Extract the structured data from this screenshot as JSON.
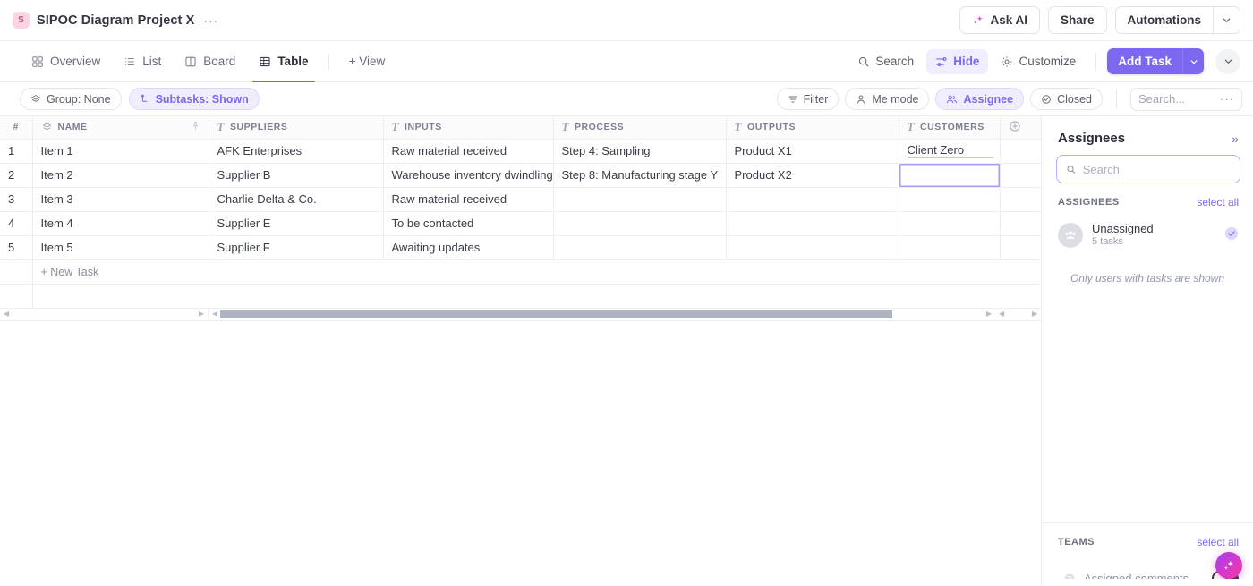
{
  "topbar": {
    "badge_letter": "S",
    "title": "SIPOC Diagram Project X",
    "more_label": "···",
    "ask_ai_label": "Ask AI",
    "share_label": "Share",
    "automations_label": "Automations"
  },
  "viewbar": {
    "tabs": [
      {
        "label": "Overview",
        "icon": "grid-icon",
        "active": false
      },
      {
        "label": "List",
        "icon": "list-icon",
        "active": false
      },
      {
        "label": "Board",
        "icon": "board-icon",
        "active": false
      },
      {
        "label": "Table",
        "icon": "table-icon",
        "active": true
      }
    ],
    "add_view_label": "+ View",
    "search_label": "Search",
    "hide_label": "Hide",
    "customize_label": "Customize",
    "add_task_label": "Add Task"
  },
  "filterbar": {
    "group_label": "Group: None",
    "subtasks_label": "Subtasks: Shown",
    "filter_label": "Filter",
    "me_mode_label": "Me mode",
    "assignee_label": "Assignee",
    "closed_label": "Closed",
    "search_placeholder": "Search...",
    "search_value": "",
    "search_more": "···"
  },
  "table": {
    "columns": [
      {
        "key": "num",
        "label": "#"
      },
      {
        "key": "name",
        "label": "NAME"
      },
      {
        "key": "suppliers",
        "label": "SUPPLIERS"
      },
      {
        "key": "inputs",
        "label": "INPUTS"
      },
      {
        "key": "process",
        "label": "PROCESS"
      },
      {
        "key": "outputs",
        "label": "OUTPUTS"
      },
      {
        "key": "customers",
        "label": "CUSTOMERS"
      }
    ],
    "rows": [
      {
        "num": "1",
        "name": "Item 1",
        "suppliers": "AFK Enterprises",
        "inputs": "Raw material received",
        "process": "Step 4: Sampling",
        "outputs": "Product X1",
        "customers": "Client Zero"
      },
      {
        "num": "2",
        "name": "Item 2",
        "suppliers": "Supplier B",
        "inputs": "Warehouse inventory dwindling",
        "process": "Step 8: Manufacturing stage Y",
        "outputs": "Product X2",
        "customers": ""
      },
      {
        "num": "3",
        "name": "Item 3",
        "suppliers": "Charlie Delta & Co.",
        "inputs": "Raw material received",
        "process": "",
        "outputs": "",
        "customers": ""
      },
      {
        "num": "4",
        "name": "Item 4",
        "suppliers": "Supplier E",
        "inputs": "To be contacted",
        "process": "",
        "outputs": "",
        "customers": ""
      },
      {
        "num": "5",
        "name": "Item 5",
        "suppliers": "Supplier F",
        "inputs": "Awaiting updates",
        "process": "",
        "outputs": "",
        "customers": ""
      }
    ],
    "new_task_label": "+ New Task"
  },
  "panel": {
    "title": "Assignees",
    "search_placeholder": "Search",
    "search_value": "",
    "assignees_label": "ASSIGNEES",
    "select_all_label": "select all",
    "assignee_name": "Unassigned",
    "assignee_tasks": "5 tasks",
    "note": "Only users with tasks are shown",
    "teams_label": "TEAMS",
    "teams_select_all_label": "select all",
    "assigned_comments_label": "Assigned comments"
  },
  "colors": {
    "accent": "#7b68ee",
    "accent_soft": "#f0eefe",
    "badge_pink_bg": "#fbd4e4",
    "badge_pink_fg": "#c0507f",
    "border": "#edeef1",
    "text": "#3a3d47",
    "muted": "#9aa0ad",
    "scrollbar_thumb": "#aeb4c0"
  }
}
